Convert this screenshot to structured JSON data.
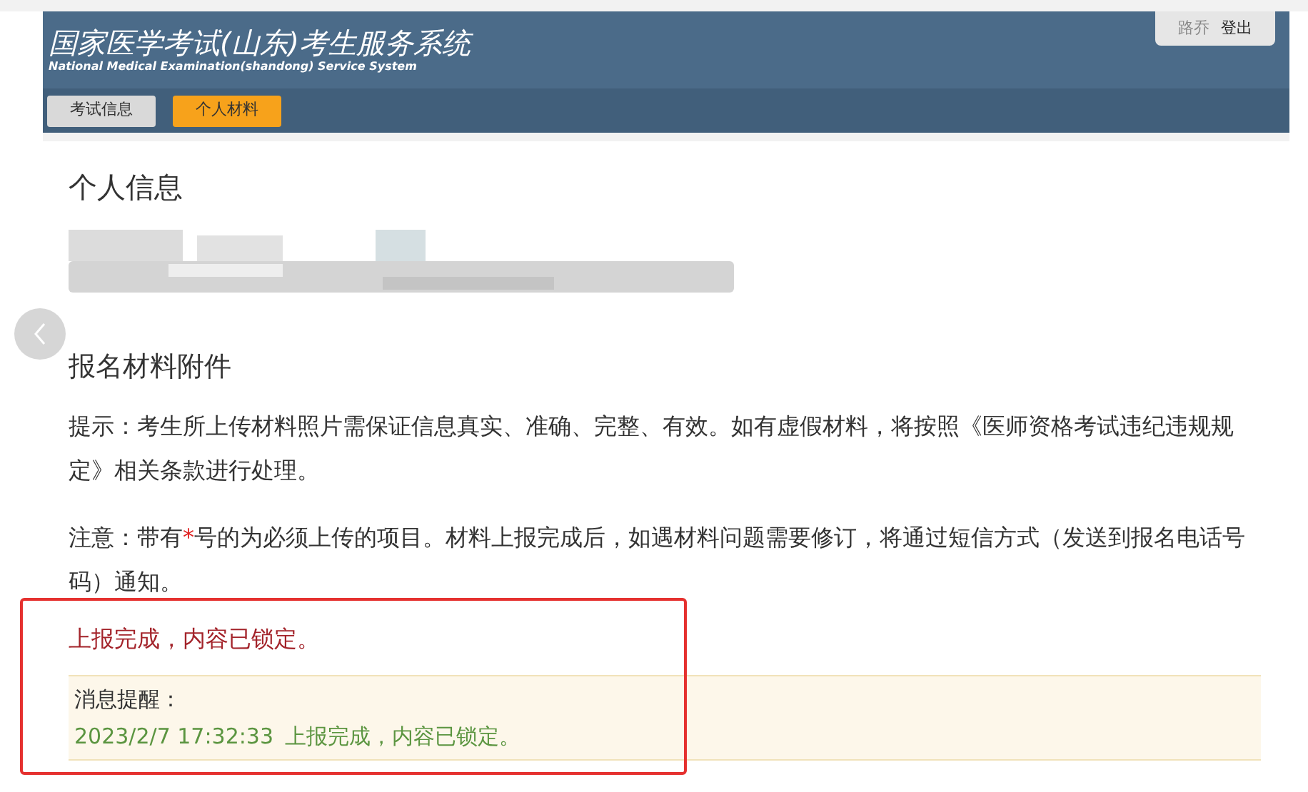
{
  "header": {
    "title": "国家医学考试(山东)考生服务系统",
    "subtitle": "National Medical Examination(shandong) Service System",
    "user": "路乔",
    "logout": "登出"
  },
  "nav_tabs": [
    {
      "label": "考试信息",
      "selected": false
    },
    {
      "label": "个人材料",
      "selected": true
    }
  ],
  "personal_info": {
    "heading": "个人信息"
  },
  "attachments": {
    "heading": "报名材料附件",
    "tip": "提示：考生所上传材料照片需保证信息真实、准确、完整、有效。如有虚假材料，将按照《医师资格考试违纪违规规定》相关条款进行处理。",
    "note_parts": [
      {
        "kind": "text",
        "text": "注意：带有"
      },
      {
        "kind": "required-mark",
        "text": "*"
      },
      {
        "kind": "text",
        "text": "号的为必须上传的项目。材料上报完成后，如遇材料问题需要修订，将通过短信方式（发送到报名电话号码）通知。"
      }
    ],
    "status": "上报完成，内容已锁定。",
    "message": {
      "label": "消息提醒：",
      "time": "2023/2/7 17:32:33",
      "text": "上报完成，内容已锁定。"
    }
  }
}
